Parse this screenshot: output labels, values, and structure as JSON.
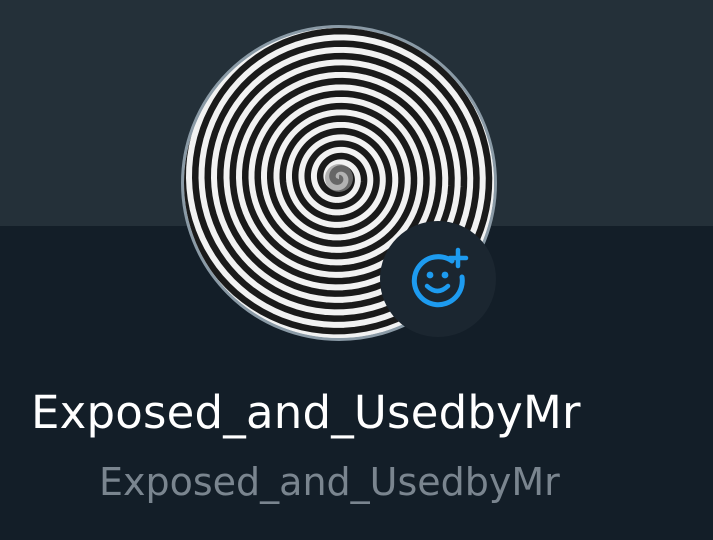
{
  "profile": {
    "display_name": "Exposed_and_UsedbyMr",
    "username": "Exposed_and_UsedbyMr",
    "avatar_icon": "hypnotic-spiral-image",
    "add_reaction_icon": "smiley-plus-icon"
  },
  "colors": {
    "banner": "#243039",
    "background": "#131e28",
    "accent": "#1d9bf0",
    "avatar_border": "#8a9aa6",
    "secondary_text": "#7a858f"
  }
}
